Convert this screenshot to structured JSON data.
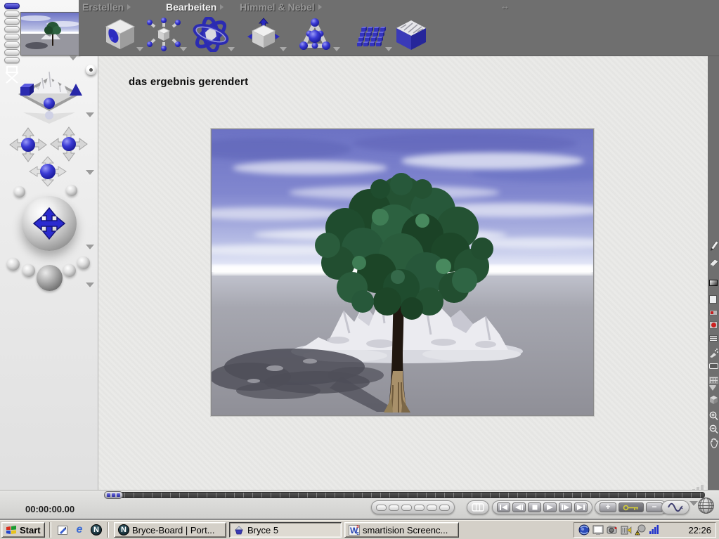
{
  "app": {
    "name": "Bryce 5"
  },
  "top_menu": {
    "tabs": [
      {
        "label": "Erstellen",
        "active": false
      },
      {
        "label": "Bearbeiten",
        "active": true
      },
      {
        "label": "Himmel & Nebel",
        "active": false
      }
    ]
  },
  "toolbar": {
    "icons": [
      "edit-texture-cube",
      "multi-replicate",
      "edit-materials",
      "resize-object",
      "link-objects",
      "terrain-grid",
      "terrain-cube"
    ]
  },
  "sidebar": {
    "controls": [
      "director-chair",
      "camera-indicator-dot",
      "scene-preview",
      "pan-pad-left",
      "pan-pad-right",
      "pan-pad-down",
      "camera-trackball",
      "view-preset-spheres"
    ]
  },
  "canvas": {
    "title": "das ergebnis gerendert"
  },
  "animation": {
    "timecode": "00:00:00.00",
    "transport": [
      "go-start",
      "step-back",
      "stop",
      "play",
      "step-forward",
      "go-end"
    ],
    "keyframe_buttons": {
      "add": "+",
      "remove": "−"
    }
  },
  "right_tools": [
    "pencil",
    "eraser",
    "gradient",
    "page",
    "render-dot-small",
    "render-dot",
    "scanlines",
    "airbrush",
    "marquee",
    "grid",
    "cube",
    "zoom-in",
    "zoom-out",
    "pan-hand"
  ],
  "taskbar": {
    "start_label": "Start",
    "quick_launch": [
      {
        "name": "show-desktop"
      },
      {
        "name": "internet-explorer",
        "glyph": "e"
      },
      {
        "name": "netscape-navigator",
        "glyph": "N"
      }
    ],
    "tasks": [
      {
        "label": "Bryce-Board | Port...",
        "glyph": "N",
        "active": false
      },
      {
        "label": "Bryce 5",
        "active": true
      },
      {
        "label": "smartision Screenc...",
        "glyph": "W",
        "glyph_sub_top": "s",
        "glyph_sub_bottom": "c",
        "active": false
      }
    ],
    "tray_icons": [
      "scheduler-globe",
      "display-settings",
      "screen-capture",
      "audio-mixer",
      "system-alert",
      "network-signal"
    ],
    "clock": "22:26"
  },
  "colors": {
    "frame_gray": "#6f6f6f",
    "canvas_bg": "#e9e9e7",
    "accent_blue": "#2a2ac2",
    "taskbar_bg": "#d4d0c8",
    "key_yellow": "#d2cb3a",
    "sky_blue": "#7177c8",
    "tree_green": "#245233"
  }
}
